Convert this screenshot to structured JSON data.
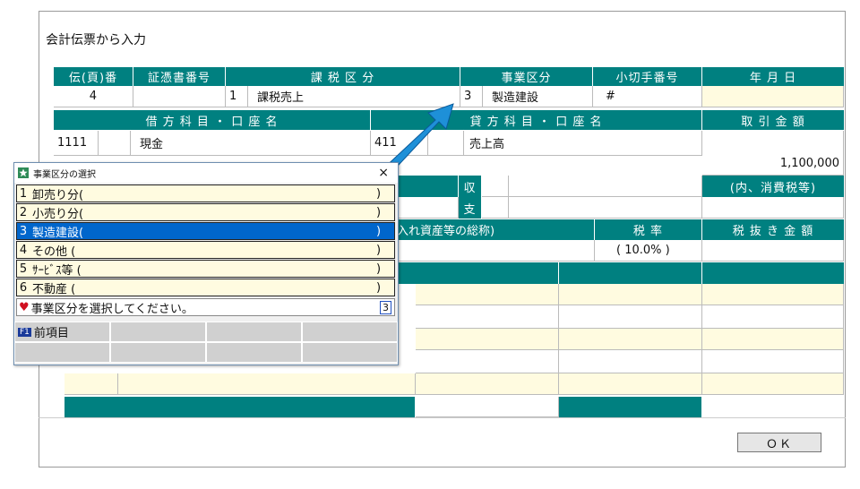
{
  "window": {
    "title": "会計伝票から入力",
    "ok_label": "ＯＫ"
  },
  "header_row1": [
    "伝(頁)番",
    "証憑書番号",
    "課 税 区 分",
    "事業区分",
    "小切手番号",
    "年 月 日"
  ],
  "row1": {
    "page_no": "4",
    "voucher_no": "",
    "tax_code": "1",
    "tax_name": "課税売上",
    "biz_code": "3",
    "biz_name": "製造建設",
    "check_no": "#",
    "date": ""
  },
  "header_row2": {
    "debit": "借 方 科 目 ・ 口 座 名",
    "credit": "貸 方 科 目 ・ 口 座 名",
    "amount": "取 引 金 額"
  },
  "row2": {
    "debit_code": "1111",
    "debit_name": "現金",
    "credit_code": "411",
    "credit_name": "売上高",
    "amount": "1,100,000"
  },
  "tax_labels": {
    "receive": "収",
    "pay": "支",
    "incl_tax": "(内、消費税等)"
  },
  "header_row3": {
    "asset": "仕入れ資産等の総称)",
    "rate": "税 率",
    "net": "税 抜 き 金 額"
  },
  "rate_value": "( 10.0% )",
  "dialog": {
    "title": "事業区分の選択",
    "close": "×",
    "options": [
      {
        "num": "1",
        "label": "卸売り分(",
        "close": ")"
      },
      {
        "num": "2",
        "label": "小売り分(",
        "close": ")"
      },
      {
        "num": "3",
        "label": "製造建設(",
        "close": ")"
      },
      {
        "num": "4",
        "label": "その他  (",
        "close": ")"
      },
      {
        "num": "5",
        "label": "ｻｰﾋﾞｽ等 (",
        "close": ")"
      },
      {
        "num": "6",
        "label": "不動産  (",
        "close": ")"
      }
    ],
    "selected_index": 2,
    "prompt": "事業区分を選択してください。",
    "input_value": "3",
    "fkey_badge": "F1",
    "fkey_label": "前項目"
  },
  "colors": {
    "teal": "#008080",
    "highlight": "#0066cc",
    "cream": "#fffbe0",
    "arrow": "#1e90d8"
  }
}
